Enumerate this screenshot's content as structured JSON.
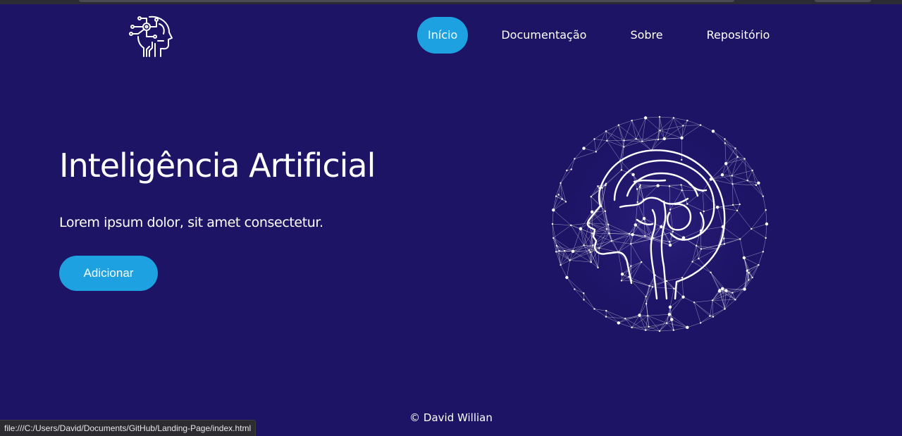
{
  "nav": {
    "items": [
      {
        "label": "Início",
        "active": true
      },
      {
        "label": "Documentação",
        "active": false
      },
      {
        "label": "Sobre",
        "active": false
      },
      {
        "label": "Repositório",
        "active": false
      }
    ]
  },
  "hero": {
    "title": "Inteligência Artificial",
    "subtitle": "Lorem ipsum dolor, sit amet consectetur.",
    "cta_label": "Adicionar"
  },
  "footer": {
    "text": "© David Willian"
  },
  "status_bar": {
    "url": "file:///C:/Users/David/Documents/GitHub/Landing-Page/index.html"
  },
  "icons": {
    "logo": "ai-head-circuit-icon",
    "hero_image": "brain-network-globe-icon"
  },
  "colors": {
    "background": "#1e1466",
    "accent": "#1ea1e0",
    "text": "#ffffff"
  }
}
